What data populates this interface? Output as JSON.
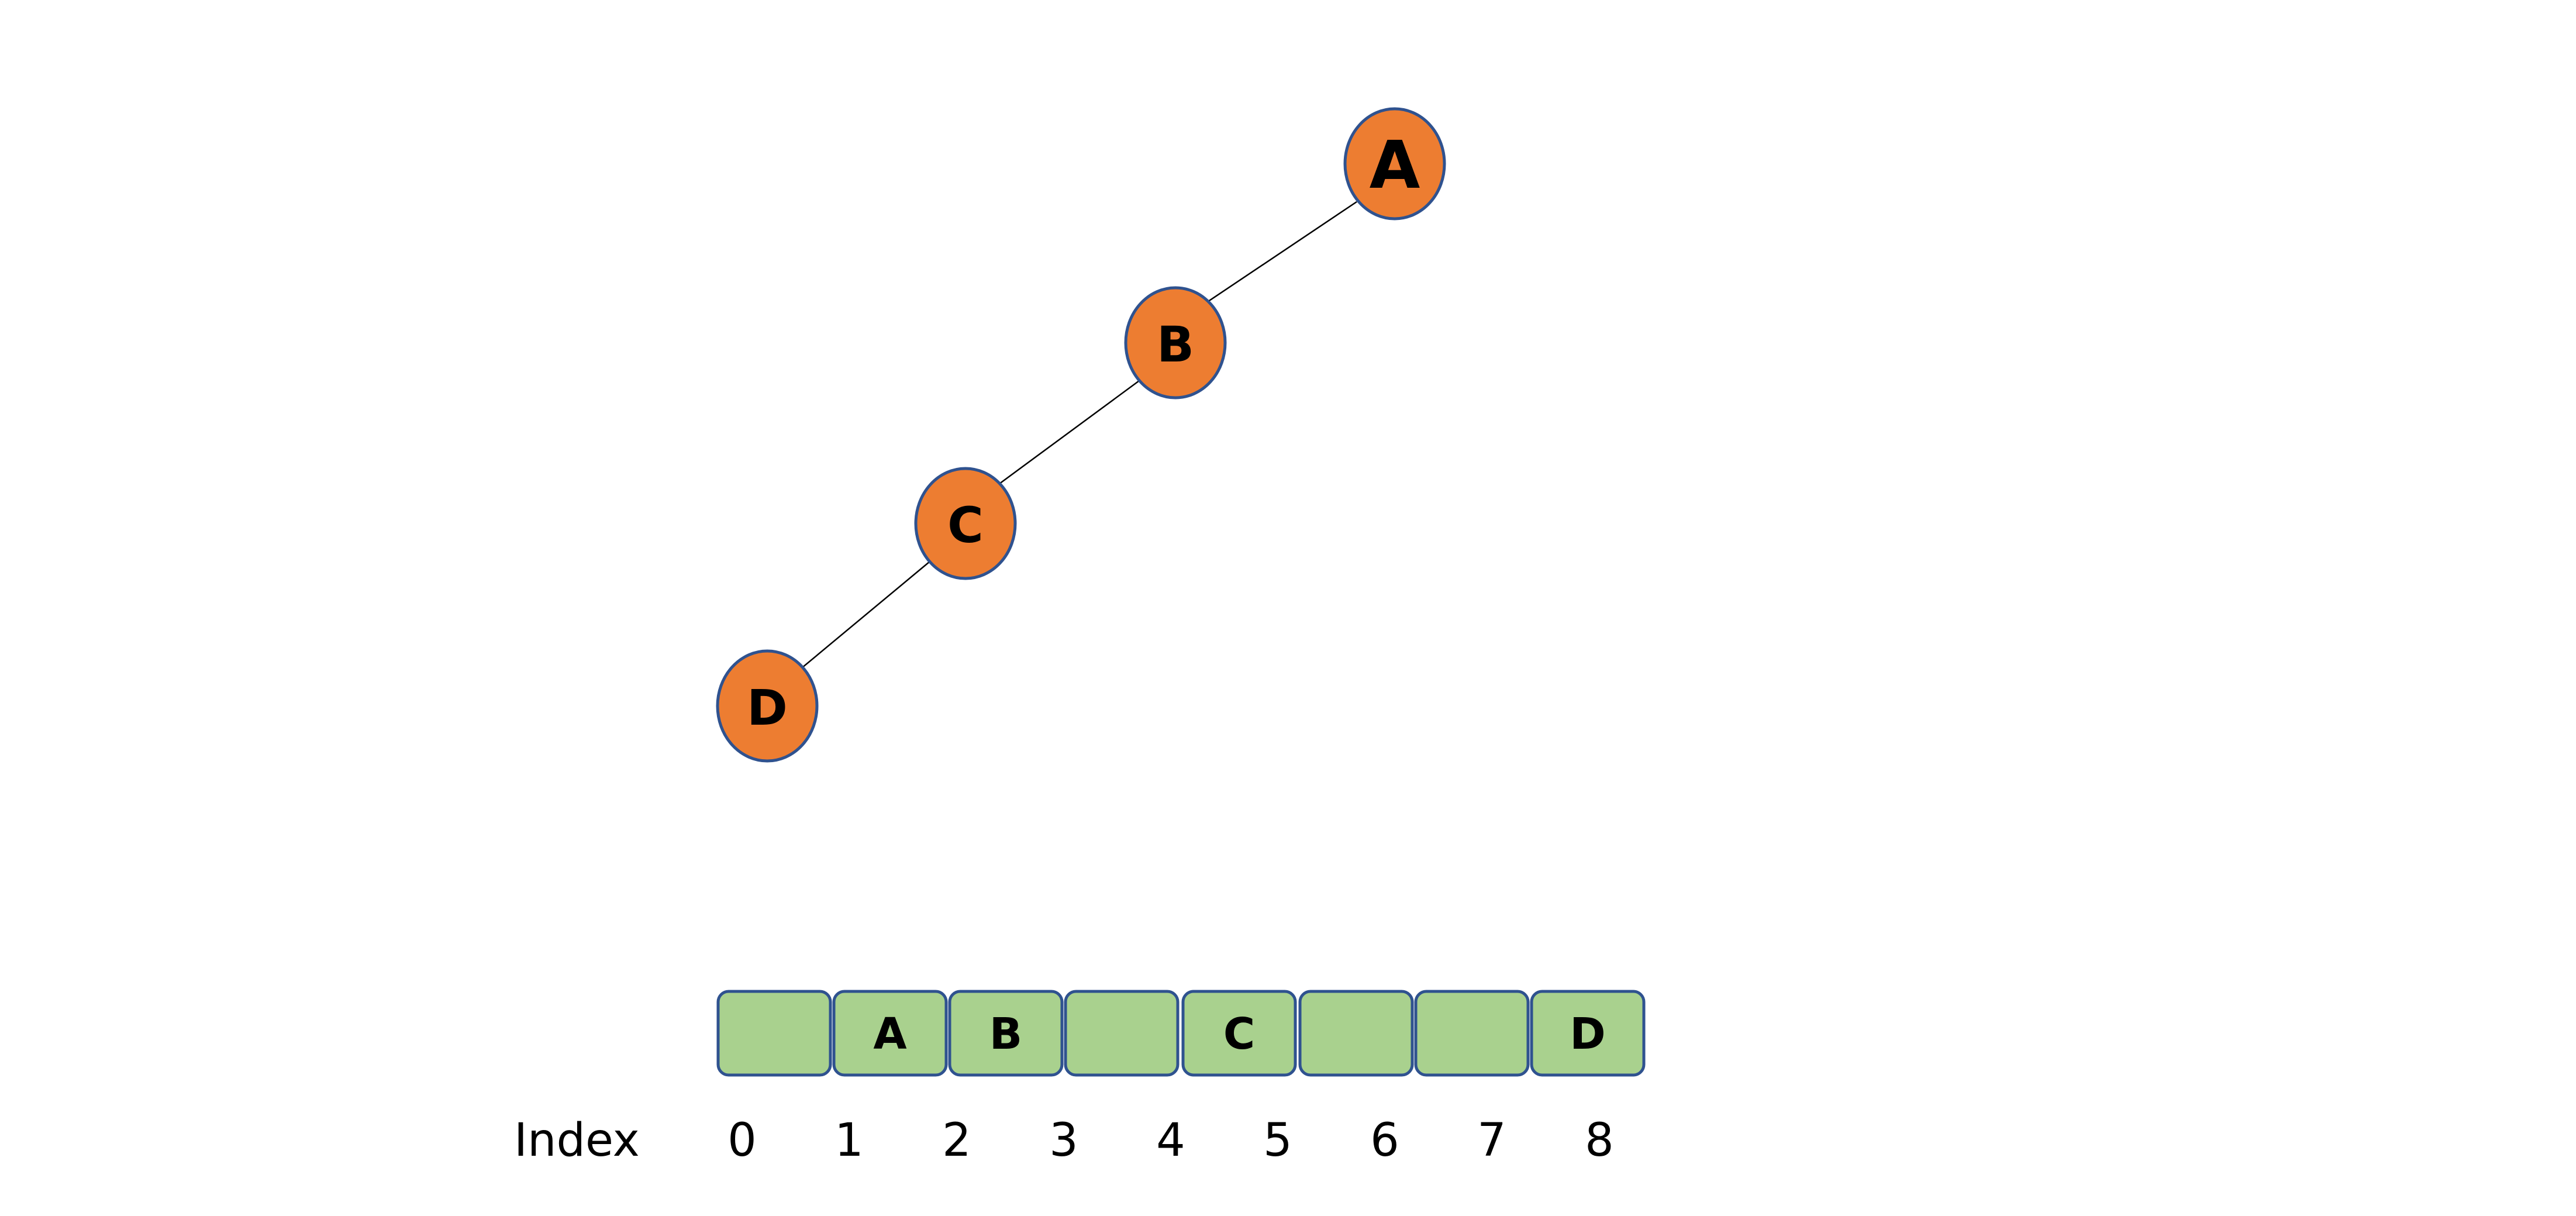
{
  "colors": {
    "node_fill": "#ED7D31",
    "node_stroke": "#2F528F",
    "cell_fill": "#A9D18E",
    "cell_stroke": "#2F528F",
    "edge": "#000000"
  },
  "tree": {
    "nodes": [
      "A",
      "B",
      "C",
      "D"
    ],
    "edges": [
      [
        "A",
        "B"
      ],
      [
        "B",
        "C"
      ],
      [
        "C",
        "D"
      ]
    ]
  },
  "array": {
    "caption": "Index",
    "cells": [
      "",
      "A",
      "B",
      "",
      "C",
      "",
      "",
      "D"
    ],
    "indices": [
      "0",
      "1",
      "2",
      "3",
      "4",
      "5",
      "6",
      "7",
      "8"
    ]
  }
}
